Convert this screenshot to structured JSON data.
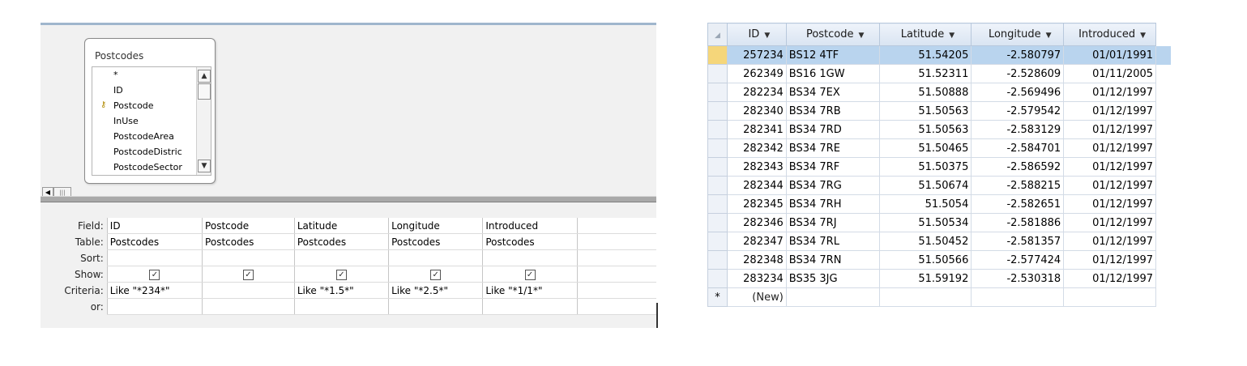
{
  "query_design": {
    "field_list": {
      "title": "Postcodes",
      "fields": [
        "*",
        "ID",
        "Postcode",
        "InUse",
        "PostcodeArea",
        "PostcodeDistric",
        "PostcodeSector"
      ],
      "key_field": "Postcode"
    },
    "grid": {
      "row_labels": {
        "field": "Field:",
        "table": "Table:",
        "sort": "Sort:",
        "show": "Show:",
        "criteria": "Criteria:",
        "or": "or:"
      },
      "columns": [
        {
          "field": "ID",
          "table": "Postcodes",
          "sort": "",
          "show": true,
          "criteria": "Like \"*234*\""
        },
        {
          "field": "Postcode",
          "table": "Postcodes",
          "sort": "",
          "show": true,
          "criteria": ""
        },
        {
          "field": "Latitude",
          "table": "Postcodes",
          "sort": "",
          "show": true,
          "criteria": "Like \"*1.5*\""
        },
        {
          "field": "Longitude",
          "table": "Postcodes",
          "sort": "",
          "show": true,
          "criteria": "Like \"*2.5*\""
        },
        {
          "field": "Introduced",
          "table": "Postcodes",
          "sort": "",
          "show": true,
          "criteria": "Like \"*1/1*\""
        }
      ]
    }
  },
  "datasheet": {
    "headers": [
      "ID",
      "Postcode",
      "Latitude",
      "Longitude",
      "Introduced"
    ],
    "rows": [
      [
        "257234",
        "BS12 4TF",
        "51.54205",
        "-2.580797",
        "01/01/1991"
      ],
      [
        "262349",
        "BS16 1GW",
        "51.52311",
        "-2.528609",
        "01/11/2005"
      ],
      [
        "282234",
        "BS34 7EX",
        "51.50888",
        "-2.569496",
        "01/12/1997"
      ],
      [
        "282340",
        "BS34 7RB",
        "51.50563",
        "-2.579542",
        "01/12/1997"
      ],
      [
        "282341",
        "BS34 7RD",
        "51.50563",
        "-2.583129",
        "01/12/1997"
      ],
      [
        "282342",
        "BS34 7RE",
        "51.50465",
        "-2.584701",
        "01/12/1997"
      ],
      [
        "282343",
        "BS34 7RF",
        "51.50375",
        "-2.586592",
        "01/12/1997"
      ],
      [
        "282344",
        "BS34 7RG",
        "51.50674",
        "-2.588215",
        "01/12/1997"
      ],
      [
        "282345",
        "BS34 7RH",
        "51.5054",
        "-2.582651",
        "01/12/1997"
      ],
      [
        "282346",
        "BS34 7RJ",
        "51.50534",
        "-2.581886",
        "01/12/1997"
      ],
      [
        "282347",
        "BS34 7RL",
        "51.50452",
        "-2.581357",
        "01/12/1997"
      ],
      [
        "282348",
        "BS34 7RN",
        "51.50566",
        "-2.577424",
        "01/12/1997"
      ],
      [
        "283234",
        "BS35 3JG",
        "51.59192",
        "-2.530318",
        "01/12/1997"
      ]
    ],
    "new_row_marker": "*",
    "new_row_label": "(New)",
    "current_row_index": 0
  }
}
